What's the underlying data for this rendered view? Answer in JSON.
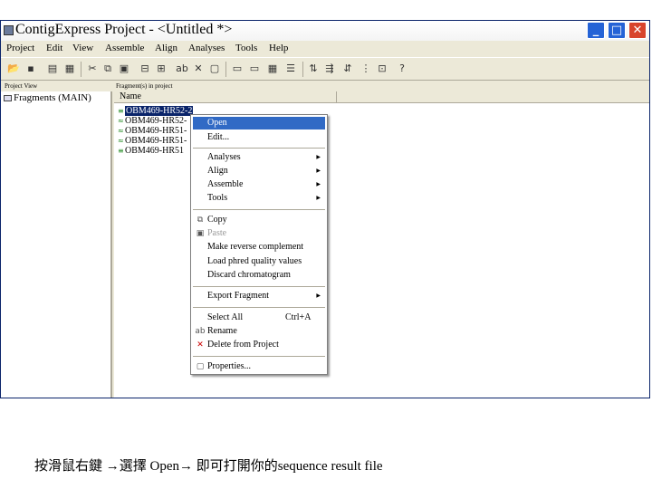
{
  "window": {
    "title": "ContigExpress Project - <Untitled *>",
    "controls": {
      "minimize": "_",
      "maximize": "□",
      "close": "✕"
    }
  },
  "menubar": {
    "items": [
      "Project",
      "Edit",
      "View",
      "Assemble",
      "Align",
      "Analyses",
      "Tools",
      "Help"
    ]
  },
  "toolbar": {
    "icons": [
      "open-icon",
      "save-icon",
      "print-icon",
      "grid-icon",
      "cut-icon",
      "copy-icon",
      "paste-icon",
      "delete-icon",
      "rename-icon",
      "view1-icon",
      "view2-icon",
      "view3-icon",
      "view4-icon",
      "align-icon",
      "assemble-icon",
      "sort-icon",
      "properties-icon",
      "help-icon"
    ]
  },
  "left_panel": {
    "header": "Project View",
    "tree": [
      {
        "label": "Fragments (MAIN)",
        "icon": "folder-icon"
      }
    ]
  },
  "right_panel": {
    "header": "Fragment(s) in project",
    "column": "Name",
    "rows": [
      {
        "name": "OBM469-HR52-2",
        "selected": true
      },
      {
        "name": "OBM469-HR52-",
        "selected": false
      },
      {
        "name": "OBM469-HR51-",
        "selected": false
      },
      {
        "name": "OBM469-HR51-",
        "selected": false
      },
      {
        "name": "OBM469-HR51",
        "selected": false
      }
    ]
  },
  "context_menu": {
    "items": [
      {
        "label": "Open",
        "highlighted": true
      },
      {
        "label": "Edit..."
      },
      {
        "separator": true
      },
      {
        "label": "Analyses",
        "submenu": true
      },
      {
        "label": "Align",
        "submenu": true
      },
      {
        "label": "Assemble",
        "submenu": true
      },
      {
        "label": "Tools",
        "submenu": true
      },
      {
        "separator": true
      },
      {
        "label": "Copy",
        "icon": "copy-icon"
      },
      {
        "label": "Paste",
        "icon": "paste-icon",
        "disabled": true
      },
      {
        "label": "Make reverse complement"
      },
      {
        "label": "Load phred quality values"
      },
      {
        "label": "Discard chromatogram"
      },
      {
        "separator": true
      },
      {
        "label": "Export Fragment",
        "submenu": true
      },
      {
        "separator": true
      },
      {
        "label": "Select All",
        "shortcut": "Ctrl+A"
      },
      {
        "label": "Rename",
        "icon": "rename-icon"
      },
      {
        "label": "Delete from Project",
        "icon": "delete-icon"
      },
      {
        "separator": true
      },
      {
        "label": "Properties...",
        "icon": "properties-icon"
      }
    ]
  },
  "caption": "按滑鼠右鍵 →選擇 Open→ 即可打開你的sequence result file"
}
